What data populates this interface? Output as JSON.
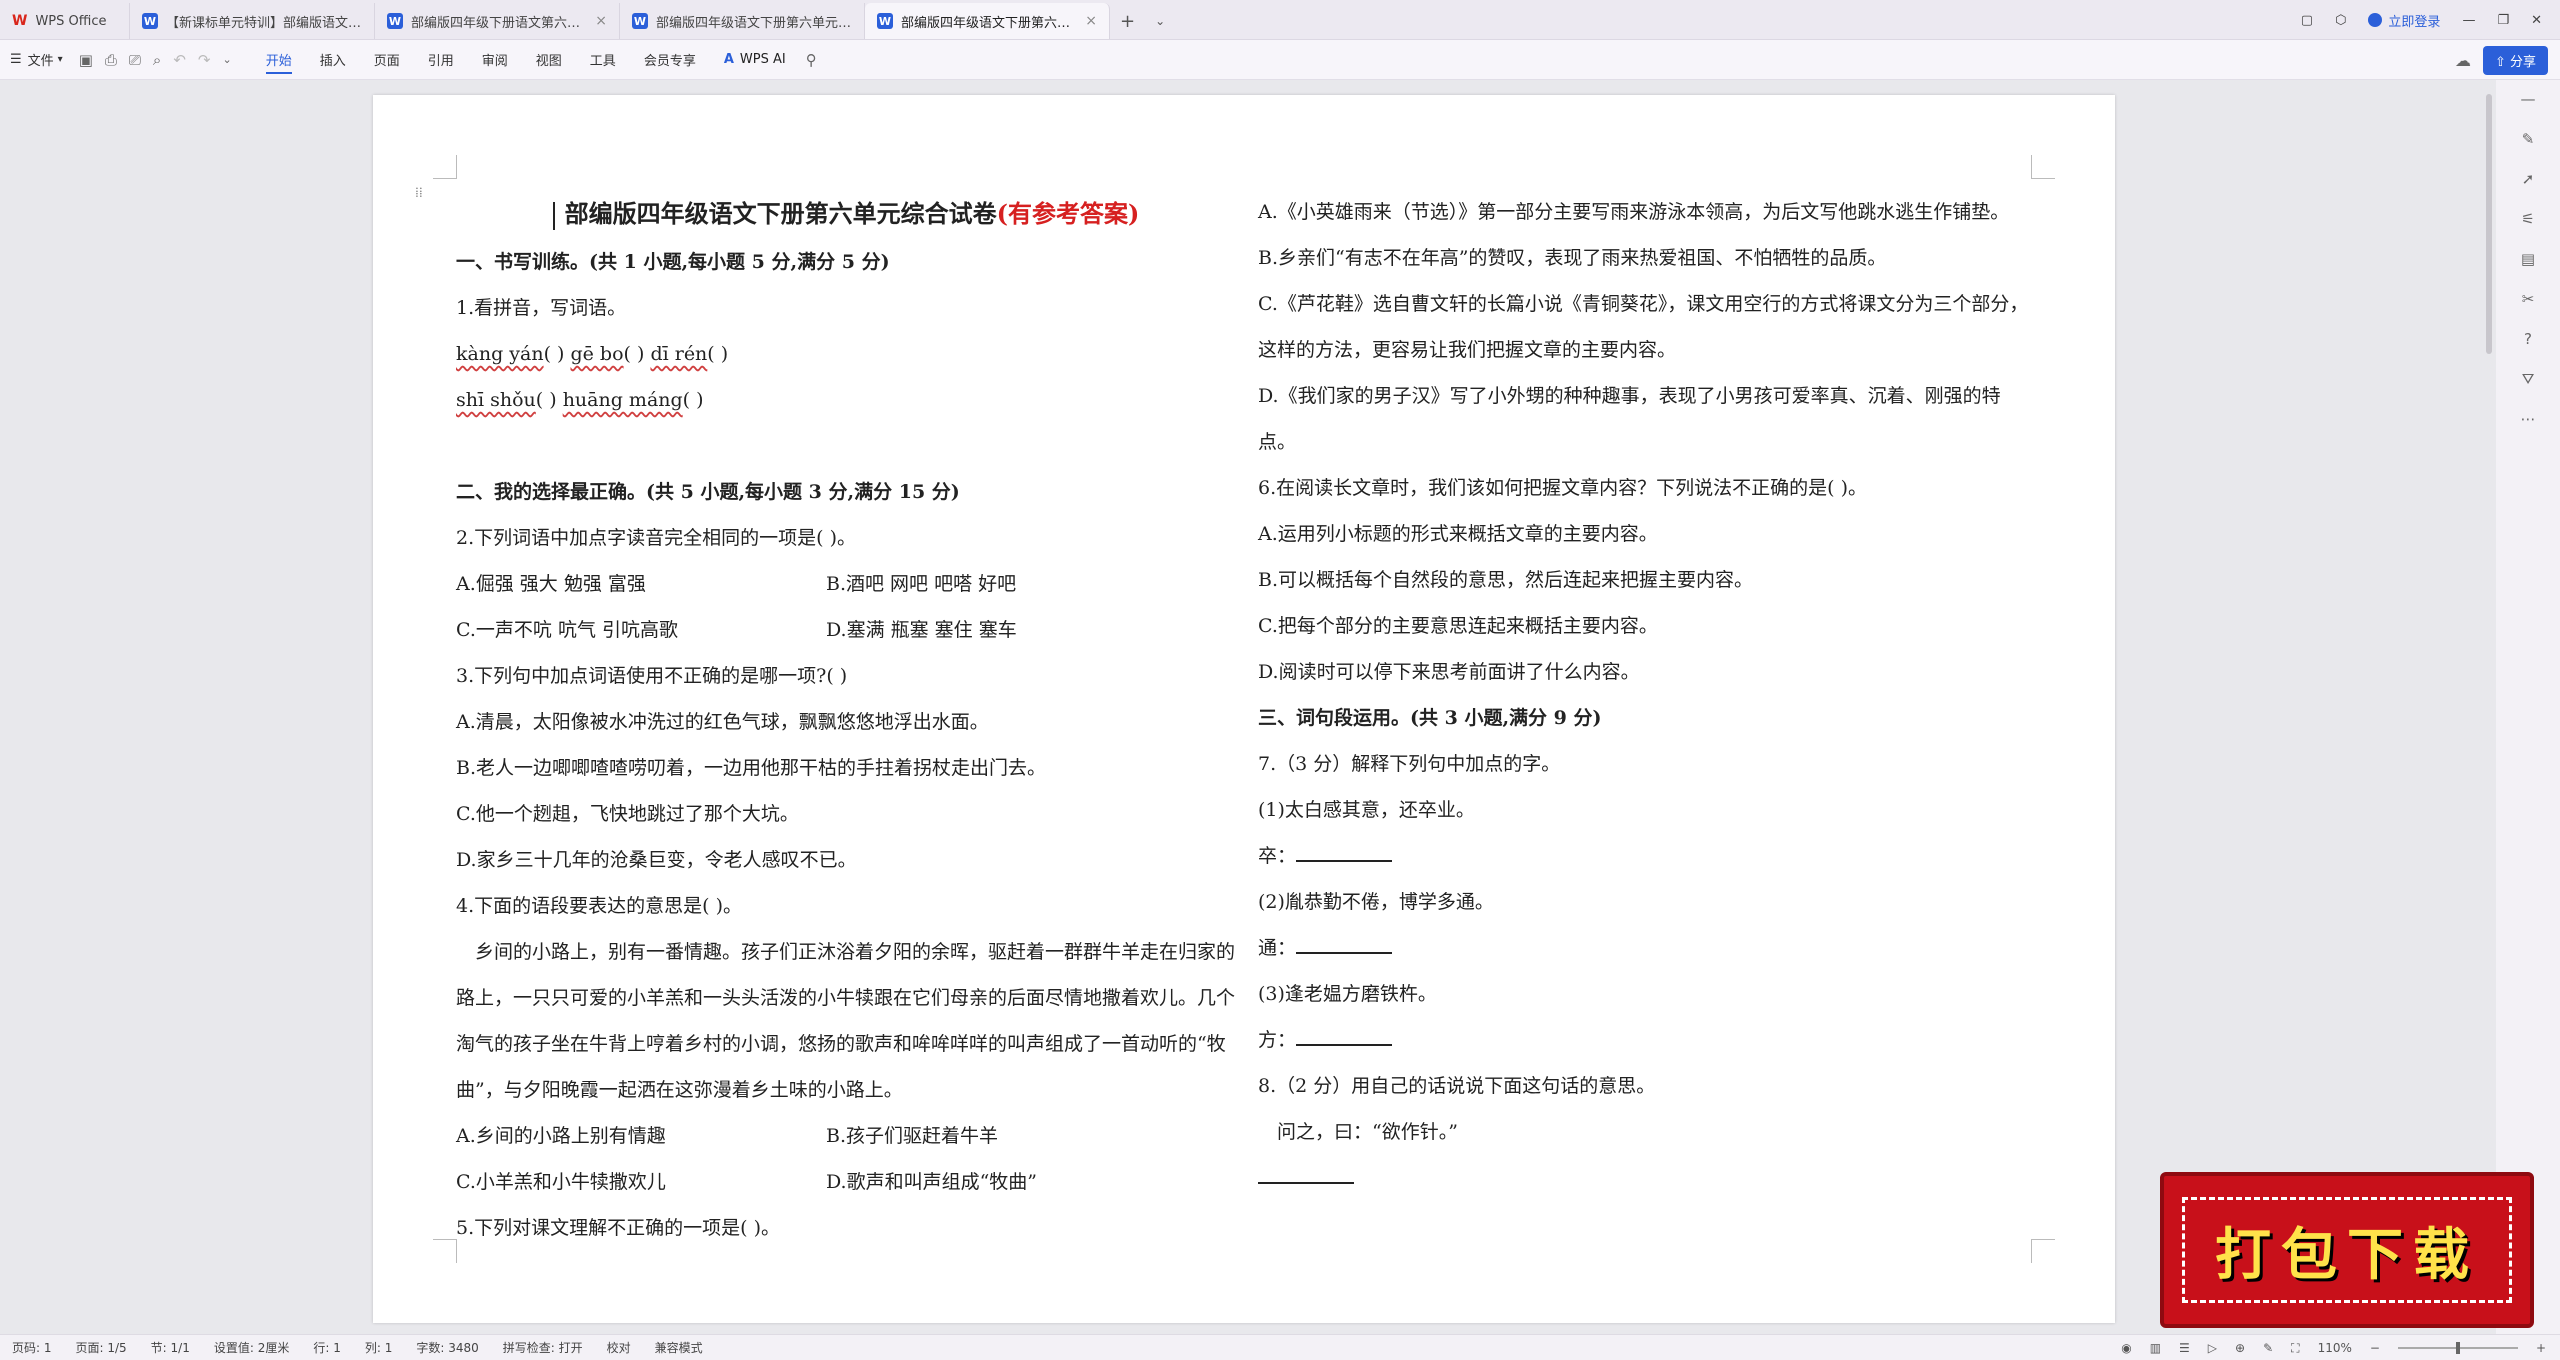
{
  "tabs": {
    "home": "WPS Office",
    "doc1": "【新课标单元特训】部编版语文四年级下册",
    "doc2": "部编版四年级下册语文第六单元测试卷",
    "doc3": "部编版四年级语文下册第六单元复习",
    "doc4": "部编版四年级语文下册第六单元综合试卷"
  },
  "title_right": {
    "login": "立即登录"
  },
  "ribbon": {
    "file": "文件",
    "menu": [
      "开始",
      "插入",
      "页面",
      "引用",
      "审阅",
      "视图",
      "工具",
      "会员专享"
    ],
    "wps_ai": "WPS AI",
    "share": "分享"
  },
  "doc": {
    "title_main": "部编版四年级语文下册第六单元综合试卷",
    "title_answer": "(有参考答案)",
    "left": {
      "s1": "一、书写训练。(共 1 小题,每小题 5 分,满分 5 分)",
      "q1": "1.看拼音，写词语。",
      "py1": [
        "kàng yán",
        "gē bo",
        "dī rén"
      ],
      "py2": [
        "shī shǒu",
        "huāng máng"
      ],
      "s2": "二、我的选择最正确。(共 5 小题,每小题 3 分,满分 15 分)",
      "q2": "2.下列词语中加点字读音完全相同的一项是(   )。",
      "q2a": "A.倔强   强大   勉强   富强",
      "q2b": "B.酒吧   网吧   吧嗒   好吧",
      "q2c": "C.一声不吭   吭气   引吭高歌",
      "q2d": "D.塞满   瓶塞   塞住   塞车",
      "q3": "3.下列句中加点词语使用不正确的是哪一项?(   )",
      "q3a": "A.清晨，太阳像被水冲洗过的红色气球，飘飘悠悠地浮出水面。",
      "q3b": "B.老人一边唧唧喳喳唠叨着，一边用他那干枯的手拄着拐杖走出门去。",
      "q3c": "C.他一个趔趄，飞快地跳过了那个大坑。",
      "q3d": "D.家乡三十几年的沧桑巨变，令老人感叹不已。",
      "q4": "4.下面的语段要表达的意思是(   )。",
      "q4p": "乡间的小路上，别有一番情趣。孩子们正沐浴着夕阳的余晖，驱赶着一群群牛羊走在归家的路上，一只只可爱的小羊羔和一头头活泼的小牛犊跟在它们母亲的后面尽情地撒着欢儿。几个淘气的孩子坐在牛背上哼着乡村的小调，悠扬的歌声和哞哞咩咩的叫声组成了一首动听的“牧曲”，与夕阳晚霞一起洒在这弥漫着乡土味的小路上。",
      "q4a": "A.乡间的小路上别有情趣",
      "q4b": "B.孩子们驱赶着牛羊",
      "q4c": "C.小羊羔和小牛犊撒欢儿",
      "q4d": "D.歌声和叫声组成“牧曲”",
      "q5": "5.下列对课文理解不正确的一项是(   )。"
    },
    "right": {
      "q5a": "A.《小英雄雨来（节选）》第一部分主要写雨来游泳本领高，为后文写他跳水逃生作铺垫。",
      "q5b": "B.乡亲们“有志不在年高”的赞叹，表现了雨来热爱祖国、不怕牺牲的品质。",
      "q5c": "C.《芦花鞋》选自曹文轩的长篇小说《青铜葵花》，课文用空行的方式将课文分为三个部分，这样的方法，更容易让我们把握文章的主要内容。",
      "q5d": "D.《我们家的男子汉》写了小外甥的种种趣事，表现了小男孩可爱率真、沉着、刚强的特点。",
      "q6": "6.在阅读长文章时，我们该如何把握文章内容？下列说法不正确的是(   )。",
      "q6a": "A.运用列小标题的形式来概括文章的主要内容。",
      "q6b": "B.可以概括每个自然段的意思，然后连起来把握主要内容。",
      "q6c": "C.把每个部分的主要意思连起来概括主要内容。",
      "q6d": "D.阅读时可以停下来思考前面讲了什么内容。",
      "s3": "三、词句段运用。(共 3 小题,满分 9 分)",
      "q7": "7.（3 分）解释下列句中加点的字。",
      "q7_1": "(1)太白感其意，还卒业。",
      "q7_1l": "卒：",
      "q7_2": "(2)胤恭勤不倦，博学多通。",
      "q7_2l": "通：",
      "q7_3": "(3)逢老媪方磨铁杵。",
      "q7_3l": "方：",
      "q8": "8.（2 分）用自己的话说说下面这句话的意思。",
      "q8q": "问之，曰：“欲作针。”"
    }
  },
  "status": {
    "page_num": "页码: 1",
    "pages": "页面: 1/5",
    "section": "节: 1/1",
    "setting": "设置值: 2厘米",
    "row": "行: 1",
    "col": "列: 1",
    "words": "字数: 3480",
    "spell": "拼写检查: 打开",
    "proof": "校对",
    "compat": "兼容模式",
    "zoom": "110%"
  },
  "badge": "打包下载",
  "colors": {
    "accent": "#2b5fd9",
    "answer_red": "#d62020",
    "badge_red": "#c8101a",
    "badge_text": "#ffe24a"
  }
}
